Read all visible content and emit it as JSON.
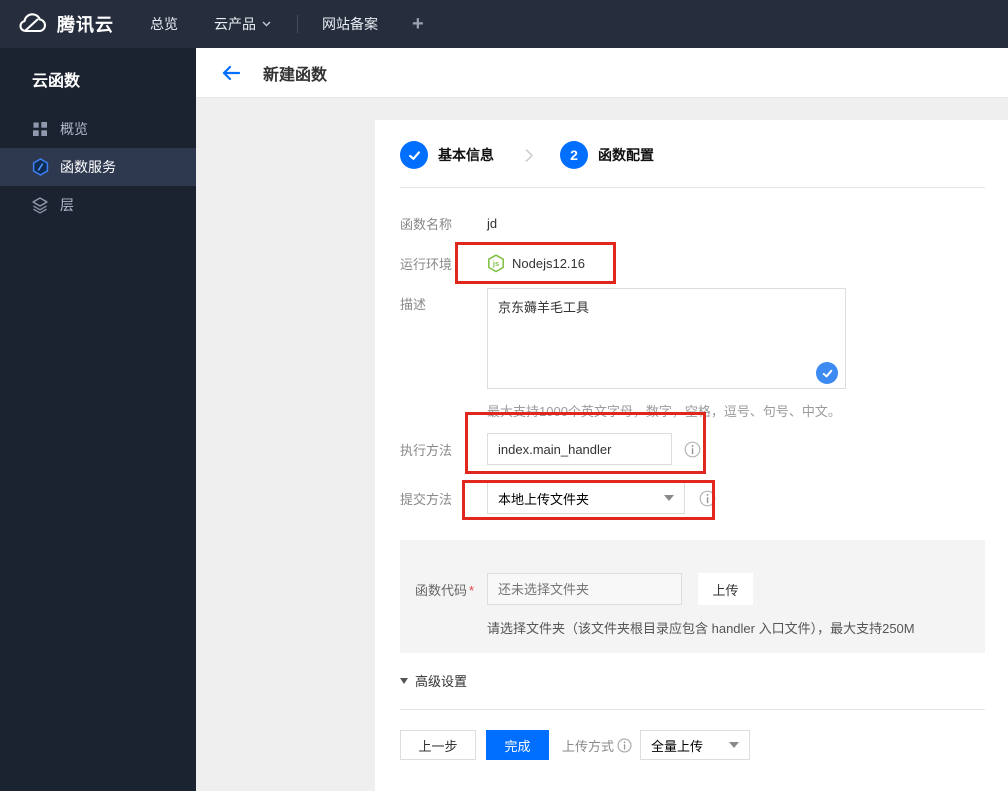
{
  "navbar": {
    "brand": "腾讯云",
    "items": [
      {
        "label": "总览"
      },
      {
        "label": "云产品"
      },
      {
        "label": "网站备案"
      },
      {
        "label": "+"
      }
    ]
  },
  "sidebar": {
    "title": "云函数",
    "items": [
      {
        "label": "概览",
        "icon": "grid-icon",
        "active": false
      },
      {
        "label": "函数服务",
        "icon": "function-hexagon-icon",
        "active": true
      },
      {
        "label": "层",
        "icon": "layers-icon",
        "active": false
      }
    ]
  },
  "header": {
    "title": "新建函数",
    "back_icon": "arrow-left-icon"
  },
  "steps": {
    "step1": {
      "label": "基本信息",
      "state": "done",
      "icon": "check-icon"
    },
    "step2": {
      "label": "函数配置",
      "number": "2",
      "state": "current"
    }
  },
  "form": {
    "name": {
      "label": "函数名称",
      "value": "jd"
    },
    "runtime": {
      "label": "运行环境",
      "value": "Nodejs12.16",
      "icon": "nodejs-icon"
    },
    "description": {
      "label": "描述",
      "value": "京东薅羊毛工具",
      "hint": "最大支持1000个英文字母，数字，空格，逗号、句号、中文。"
    },
    "handler": {
      "label": "执行方法",
      "value": "index.main_handler"
    },
    "submit_method": {
      "label": "提交方法",
      "value": "本地上传文件夹"
    },
    "code": {
      "label": "函数代码",
      "required_mark": "*",
      "placeholder": "还未选择文件夹",
      "upload_label": "上传",
      "hint": "请选择文件夹（该文件夹根目录应包含 handler 入口文件），最大支持250M"
    },
    "advanced_label": "高级设置"
  },
  "footer": {
    "prev_label": "上一步",
    "finish_label": "完成",
    "upload_mode_label": "上传方式",
    "upload_mode_value": "全量上传"
  },
  "colors": {
    "accent_blue": "#006eff",
    "annotation_red": "#e1261c",
    "node_green": "#7fbe42",
    "navbar_bg": "#262e3d",
    "sidebar_bg": "#1c2330"
  }
}
